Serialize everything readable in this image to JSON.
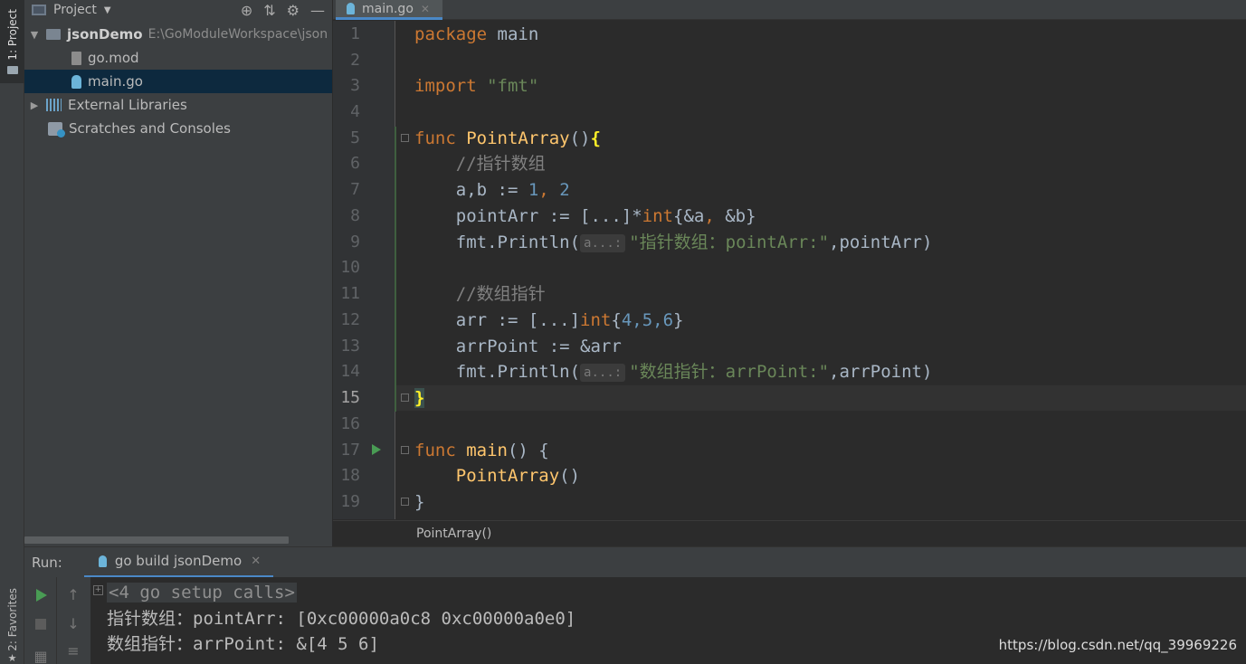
{
  "sidebar": {
    "project_tab": "1: Project",
    "favorites_tab": "2: Favorites"
  },
  "project_panel": {
    "title": "Project",
    "tree": {
      "root": {
        "name": "jsonDemo",
        "path": "E:\\GoModuleWorkspace\\json"
      },
      "files": [
        {
          "name": "go.mod"
        },
        {
          "name": "main.go"
        }
      ],
      "external_libraries": "External Libraries",
      "scratches": "Scratches and Consoles"
    }
  },
  "editor": {
    "active_tab": "main.go",
    "line_numbers": [
      "1",
      "2",
      "3",
      "4",
      "5",
      "6",
      "7",
      "8",
      "9",
      "10",
      "11",
      "12",
      "13",
      "14",
      "15",
      "16",
      "17",
      "18",
      "19"
    ],
    "current_line": 15,
    "code": {
      "l1_kw": "package",
      "l1_name": " main",
      "l3_kw": "import",
      "l3_str": "\"fmt\"",
      "l5_kw": "func",
      "l5_fn": "PointArray",
      "l5_rest": "()",
      "l5_brace": "{",
      "l6": "    //指针数组",
      "l7_a": "    a,b := ",
      "l7_n1": "1",
      "l7_sep": ", ",
      "l7_n2": "2",
      "l8_a": "    pointArr := [...]*",
      "l8_type": "int",
      "l8_b": "{&a",
      "l8_sep": ", ",
      "l8_c": "&b}",
      "l9_a": "    fmt.Println(",
      "l9_hint": "a...:",
      "l9_str": "\"指针数组：pointArr:\"",
      "l9_b": ",pointArr)",
      "l11": "    //数组指针",
      "l12_a": "    arr := [...]",
      "l12_type": "int",
      "l12_b": "{",
      "l12_n": "4,5,6",
      "l12_c": "}",
      "l13": "    arrPoint := &arr",
      "l14_a": "    fmt.Println(",
      "l14_hint": "a...:",
      "l14_str": "\"数组指针：arrPoint:\"",
      "l14_b": ",arrPoint)",
      "l15": "}",
      "l17_kw": "func",
      "l17_fn": "main",
      "l17_rest": "() {",
      "l18_fn": "    PointArray",
      "l18_rest": "()",
      "l19": "}"
    },
    "breadcrumb": "PointArray()"
  },
  "run_panel": {
    "label": "Run:",
    "tab": "go build jsonDemo",
    "console": {
      "setup_calls": "<4 go setup calls>",
      "lines": [
        "指针数组：pointArr: [0xc00000a0c8 0xc00000a0e0]",
        "数组指针：arrPoint: &[4 5 6]"
      ]
    }
  },
  "watermark": "https://blog.csdn.net/qq_39969226",
  "colors": {
    "keyword": "#cc7832",
    "function": "#ffc66d",
    "string": "#6a8759",
    "number": "#6897bb",
    "comment": "#808080",
    "selection": "#0d293e",
    "accent": "#4a88c7"
  }
}
